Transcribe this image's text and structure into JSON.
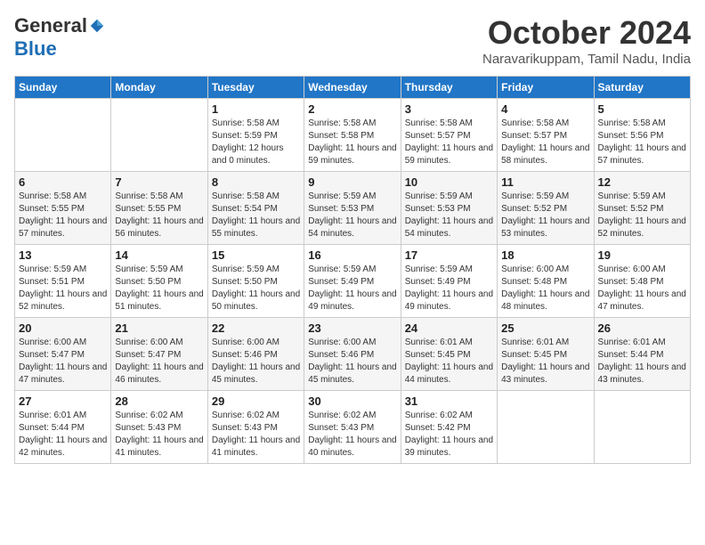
{
  "logo": {
    "general": "General",
    "blue": "Blue"
  },
  "title": "October 2024",
  "location": "Naravarikuppam, Tamil Nadu, India",
  "days_of_week": [
    "Sunday",
    "Monday",
    "Tuesday",
    "Wednesday",
    "Thursday",
    "Friday",
    "Saturday"
  ],
  "weeks": [
    [
      {
        "day": "",
        "info": ""
      },
      {
        "day": "",
        "info": ""
      },
      {
        "day": "1",
        "info": "Sunrise: 5:58 AM\nSunset: 5:59 PM\nDaylight: 12 hours\nand 0 minutes."
      },
      {
        "day": "2",
        "info": "Sunrise: 5:58 AM\nSunset: 5:58 PM\nDaylight: 11 hours\nand 59 minutes."
      },
      {
        "day": "3",
        "info": "Sunrise: 5:58 AM\nSunset: 5:57 PM\nDaylight: 11 hours\nand 59 minutes."
      },
      {
        "day": "4",
        "info": "Sunrise: 5:58 AM\nSunset: 5:57 PM\nDaylight: 11 hours\nand 58 minutes."
      },
      {
        "day": "5",
        "info": "Sunrise: 5:58 AM\nSunset: 5:56 PM\nDaylight: 11 hours\nand 57 minutes."
      }
    ],
    [
      {
        "day": "6",
        "info": "Sunrise: 5:58 AM\nSunset: 5:55 PM\nDaylight: 11 hours\nand 57 minutes."
      },
      {
        "day": "7",
        "info": "Sunrise: 5:58 AM\nSunset: 5:55 PM\nDaylight: 11 hours\nand 56 minutes."
      },
      {
        "day": "8",
        "info": "Sunrise: 5:58 AM\nSunset: 5:54 PM\nDaylight: 11 hours\nand 55 minutes."
      },
      {
        "day": "9",
        "info": "Sunrise: 5:59 AM\nSunset: 5:53 PM\nDaylight: 11 hours\nand 54 minutes."
      },
      {
        "day": "10",
        "info": "Sunrise: 5:59 AM\nSunset: 5:53 PM\nDaylight: 11 hours\nand 54 minutes."
      },
      {
        "day": "11",
        "info": "Sunrise: 5:59 AM\nSunset: 5:52 PM\nDaylight: 11 hours\nand 53 minutes."
      },
      {
        "day": "12",
        "info": "Sunrise: 5:59 AM\nSunset: 5:52 PM\nDaylight: 11 hours\nand 52 minutes."
      }
    ],
    [
      {
        "day": "13",
        "info": "Sunrise: 5:59 AM\nSunset: 5:51 PM\nDaylight: 11 hours\nand 52 minutes."
      },
      {
        "day": "14",
        "info": "Sunrise: 5:59 AM\nSunset: 5:50 PM\nDaylight: 11 hours\nand 51 minutes."
      },
      {
        "day": "15",
        "info": "Sunrise: 5:59 AM\nSunset: 5:50 PM\nDaylight: 11 hours\nand 50 minutes."
      },
      {
        "day": "16",
        "info": "Sunrise: 5:59 AM\nSunset: 5:49 PM\nDaylight: 11 hours\nand 49 minutes."
      },
      {
        "day": "17",
        "info": "Sunrise: 5:59 AM\nSunset: 5:49 PM\nDaylight: 11 hours\nand 49 minutes."
      },
      {
        "day": "18",
        "info": "Sunrise: 6:00 AM\nSunset: 5:48 PM\nDaylight: 11 hours\nand 48 minutes."
      },
      {
        "day": "19",
        "info": "Sunrise: 6:00 AM\nSunset: 5:48 PM\nDaylight: 11 hours\nand 47 minutes."
      }
    ],
    [
      {
        "day": "20",
        "info": "Sunrise: 6:00 AM\nSunset: 5:47 PM\nDaylight: 11 hours\nand 47 minutes."
      },
      {
        "day": "21",
        "info": "Sunrise: 6:00 AM\nSunset: 5:47 PM\nDaylight: 11 hours\nand 46 minutes."
      },
      {
        "day": "22",
        "info": "Sunrise: 6:00 AM\nSunset: 5:46 PM\nDaylight: 11 hours\nand 45 minutes."
      },
      {
        "day": "23",
        "info": "Sunrise: 6:00 AM\nSunset: 5:46 PM\nDaylight: 11 hours\nand 45 minutes."
      },
      {
        "day": "24",
        "info": "Sunrise: 6:01 AM\nSunset: 5:45 PM\nDaylight: 11 hours\nand 44 minutes."
      },
      {
        "day": "25",
        "info": "Sunrise: 6:01 AM\nSunset: 5:45 PM\nDaylight: 11 hours\nand 43 minutes."
      },
      {
        "day": "26",
        "info": "Sunrise: 6:01 AM\nSunset: 5:44 PM\nDaylight: 11 hours\nand 43 minutes."
      }
    ],
    [
      {
        "day": "27",
        "info": "Sunrise: 6:01 AM\nSunset: 5:44 PM\nDaylight: 11 hours\nand 42 minutes."
      },
      {
        "day": "28",
        "info": "Sunrise: 6:02 AM\nSunset: 5:43 PM\nDaylight: 11 hours\nand 41 minutes."
      },
      {
        "day": "29",
        "info": "Sunrise: 6:02 AM\nSunset: 5:43 PM\nDaylight: 11 hours\nand 41 minutes."
      },
      {
        "day": "30",
        "info": "Sunrise: 6:02 AM\nSunset: 5:43 PM\nDaylight: 11 hours\nand 40 minutes."
      },
      {
        "day": "31",
        "info": "Sunrise: 6:02 AM\nSunset: 5:42 PM\nDaylight: 11 hours\nand 39 minutes."
      },
      {
        "day": "",
        "info": ""
      },
      {
        "day": "",
        "info": ""
      }
    ]
  ]
}
